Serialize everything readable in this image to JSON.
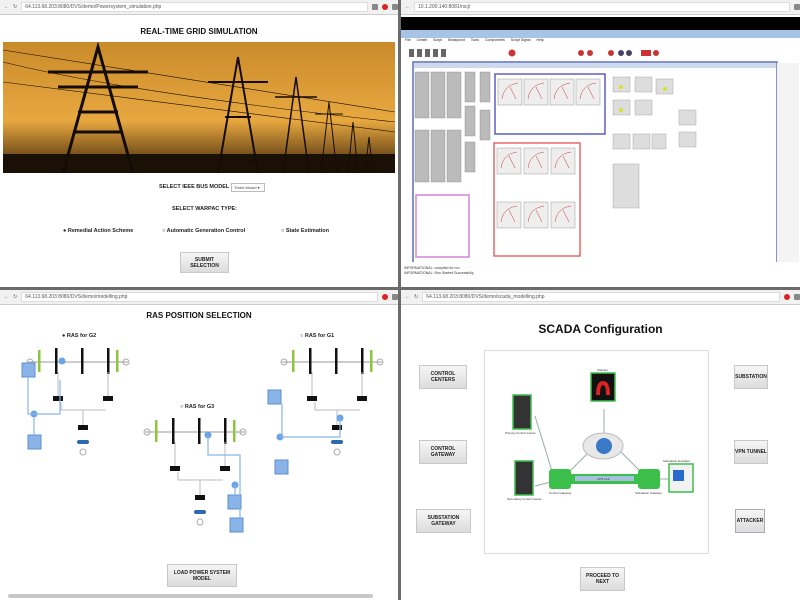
{
  "grid_sim": {
    "url": "64.113.68.203:8080/DVS/demo/Powersystem_simulation.php",
    "title": "REAL-TIME GRID SIMULATION",
    "bus_model_label": "SELECT IEEE BUS MODEL",
    "bus_model_value": "Three Model",
    "warpac_label": "SELECT WARPAC TYPE:",
    "options": [
      "Remedial Action Scheme",
      "Automatic Generation Control",
      "State Estimation"
    ],
    "submit": "SUBMIT SELECTION"
  },
  "rtds": {
    "url": "10.1.200.140:8081/rscj/",
    "menu": [
      "File",
      "Create",
      "Script",
      "Breakpoint",
      "Tools",
      "Components",
      "Script Signal",
      "Help"
    ],
    "status_lines": [
      "INFORMATIONAL: compiled for run",
      "INFORMATIONAL: Run Started Successfully"
    ]
  },
  "ras": {
    "url": "64.113.68.203:8080/DVS/demo/modelling.php",
    "title": "RAS POSITION SELECTION",
    "groups": [
      "RAS for G2",
      "RAS for G3",
      "RAS for G1"
    ],
    "load_button": "LOAD POWER SYSTEM MODEL"
  },
  "scada": {
    "url": "64.113.68.203:8080/DVS/demo/scada_modelling.php",
    "title": "SCADA Configuration",
    "left_buttons": [
      "CONTROL CENTERS",
      "CONTROL GATEWAY",
      "SUBSTATION GATEWAY"
    ],
    "right_buttons": [
      "SUBSTATION",
      "VPN TUNNEL",
      "ATTACKER"
    ],
    "proceed": "PROCEED TO NEXT",
    "nodes": {
      "attacker": "Attacker",
      "primary": "Primary Control Center",
      "secondary": "Secondary Control Center",
      "control_gw": "Control Gateway",
      "substation_gw": "Substation Gateway",
      "emulator": "Substation Emulator",
      "vpn": "VPN Link"
    },
    "colors": {
      "node_border": "#3cbf4a",
      "attacker_bg": "#111111"
    }
  }
}
